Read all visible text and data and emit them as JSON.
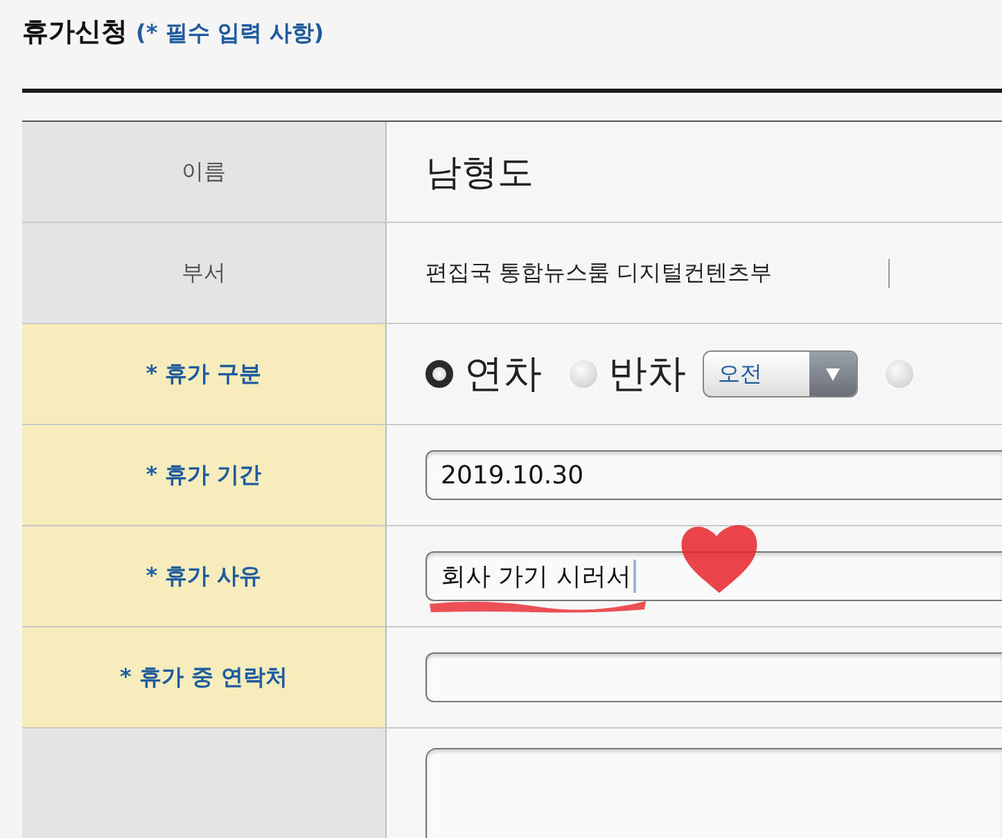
{
  "header": {
    "title": "휴가신청",
    "note": "(* 필수 입력 사항)"
  },
  "rows": [
    {
      "kind": "name",
      "label": "이름",
      "required": false,
      "value": "남형도"
    },
    {
      "kind": "department",
      "label": "부서",
      "required": false,
      "value": "편집국 통합뉴스룸 디지털컨텐츠부"
    },
    {
      "kind": "radio",
      "label": "* 휴가 구분",
      "required": true,
      "options": [
        {
          "label": "연차",
          "selected": true
        },
        {
          "label": "반차",
          "selected": false,
          "select": "오전"
        },
        {
          "selected": false
        }
      ]
    },
    {
      "kind": "input",
      "label": "* 휴가 기간",
      "required": true,
      "value": "2019.10.30",
      "focused": false,
      "doodle": false
    },
    {
      "kind": "input",
      "label": "* 휴가 사유",
      "required": true,
      "value": "회사 가기 시러서",
      "focused": true,
      "doodle": true
    },
    {
      "kind": "input",
      "label": "* 휴가 중 연락처",
      "required": true,
      "focused": false,
      "doodle": false
    },
    {
      "kind": "textarea",
      "required": false
    }
  ]
}
